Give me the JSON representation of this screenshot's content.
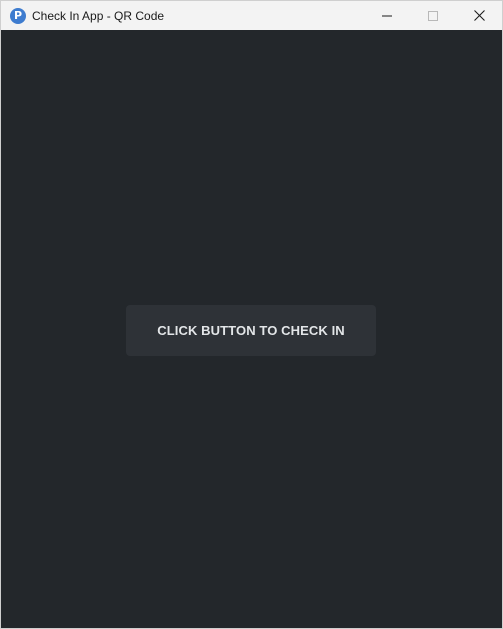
{
  "window": {
    "title": "Check In App - QR Code",
    "app_icon": "app-logo-icon",
    "app_icon_letter": "P",
    "controls": [
      "minimize-icon",
      "maximize-icon",
      "close-icon"
    ]
  },
  "main": {
    "checkin_button_label": "CLICK BUTTON TO CHECK IN"
  },
  "colors": {
    "background": "#23272b",
    "button_background": "#2e3237",
    "button_text": "#e3e6e8",
    "titlebar": "#f3f3f3",
    "app_icon": "#3e7ccf"
  }
}
